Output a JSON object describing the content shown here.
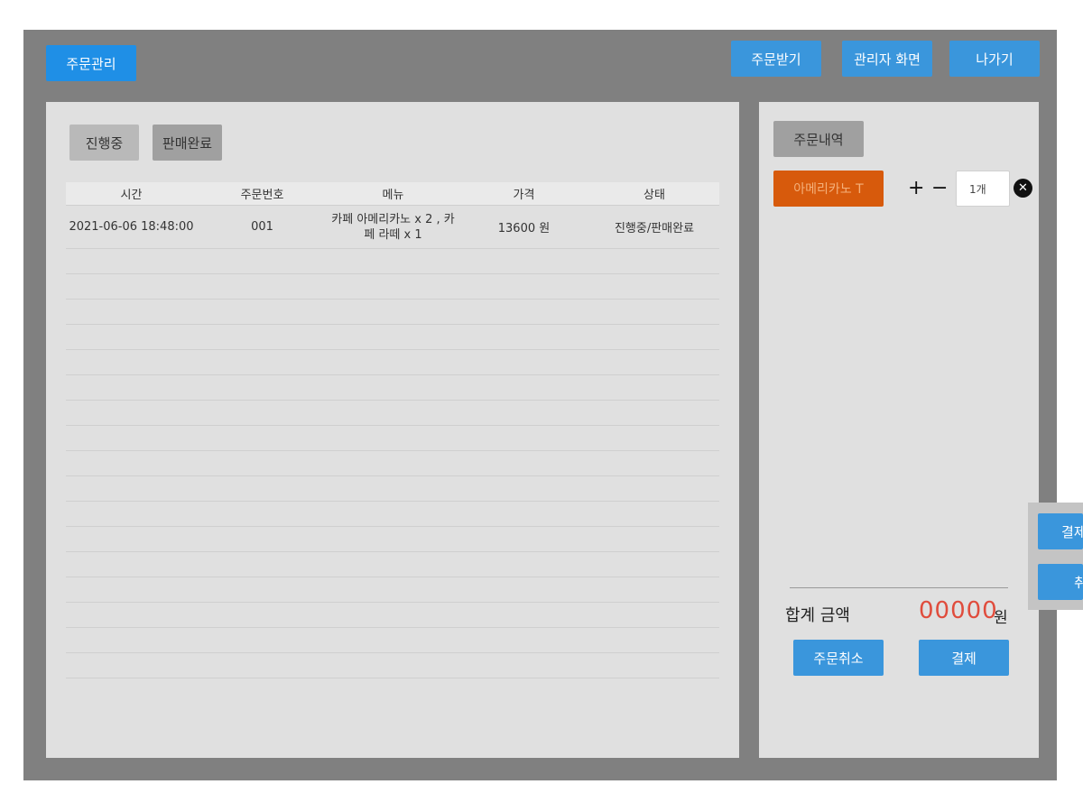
{
  "header": {
    "brand_button": "주문관리",
    "nav_buttons": [
      "주문받기",
      "관리자 화면",
      "나가기"
    ]
  },
  "filters": {
    "in_progress": "진행중",
    "completed": "판매완료"
  },
  "orders_table": {
    "headers": [
      "시간",
      "주문번호",
      "메뉴",
      "가격",
      "상태"
    ],
    "rows": [
      {
        "time": "2021-06-06 18:48:00",
        "order_no": "001",
        "menu": "카페 아메리카노 x 2 , 카페 라떼 x 1",
        "price": "13600 원",
        "status": "진행중/판매완료"
      }
    ]
  },
  "order_panel": {
    "title": "주문내역",
    "item": {
      "name": "아메리카노 T",
      "plus": "+",
      "minus": "−",
      "quantity": "1개",
      "remove": "✕"
    },
    "total_label": "합계 금액",
    "total_amount": "00000",
    "total_unit": "원",
    "cancel_button": "주문취소",
    "pay_button": "결제"
  },
  "popup": {
    "pay_button": "결제",
    "cancel_button": "취소"
  },
  "colors": {
    "frame": "#808080",
    "panel": "#e0e0e0",
    "accent_blue": "#3a96dc",
    "brand_blue": "#1f8fe6",
    "item_orange": "#d75a0c",
    "total_red": "#e04c3c"
  }
}
